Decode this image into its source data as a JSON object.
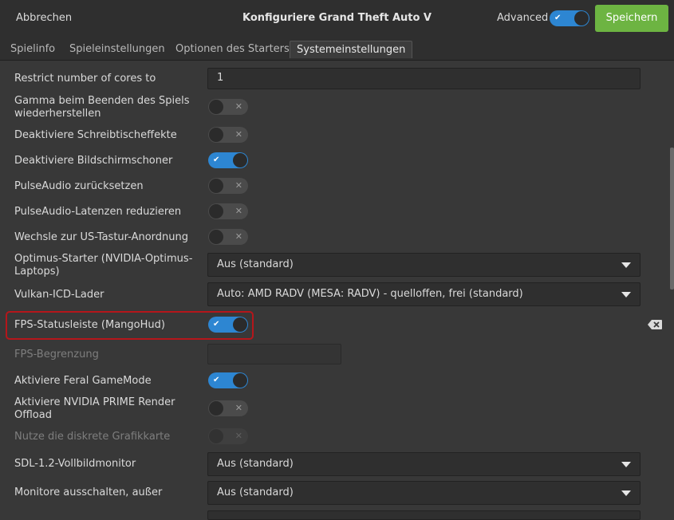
{
  "header": {
    "cancel_label": "Abbrechen",
    "title": "Konfiguriere Grand Theft Auto V",
    "advanced_label": "Advanced",
    "advanced_on": true,
    "save_label": "Speichern"
  },
  "tabs": [
    {
      "label": "Spielinfo"
    },
    {
      "label": "Spieleinstellungen"
    },
    {
      "label": "Optionen des Starters"
    },
    {
      "label": "Systemeinstellungen",
      "active": true
    }
  ],
  "settings": {
    "restrict_cores": {
      "label": "Restrict number of cores to",
      "value": "1"
    },
    "gamma_restore": {
      "label": "Gamma beim Beenden des Spiels wiederherstellen",
      "on": false
    },
    "disable_desktop_effects": {
      "label": "Deaktiviere Schreibtischeffekte",
      "on": false
    },
    "disable_screensaver": {
      "label": "Deaktiviere Bildschirmschoner",
      "on": true
    },
    "pulseaudio_reset": {
      "label": "PulseAudio zurücksetzen",
      "on": false
    },
    "pulseaudio_latency": {
      "label": "PulseAudio-Latenzen reduzieren",
      "on": false
    },
    "us_keyboard": {
      "label": "Wechsle zur US-Tastur-Anordnung",
      "on": false
    },
    "optimus": {
      "label": "Optimus-Starter (NVIDIA-Optimus-Laptops)",
      "value": "Aus (standard)"
    },
    "vulkan_icd": {
      "label": "Vulkan-ICD-Lader",
      "value": "Auto: AMD RADV (MESA: RADV) - quelloffen, frei (standard)"
    },
    "fps_mangohud": {
      "label": "FPS-Statusleiste (MangoHud)",
      "on": true
    },
    "fps_limit": {
      "label": "FPS-Begrenzung",
      "value": ""
    },
    "feral_gamemode": {
      "label": "Aktiviere Feral GameMode",
      "on": true
    },
    "nvidia_prime": {
      "label": "Aktiviere NVIDIA PRIME Render Offload",
      "on": false
    },
    "discrete_gpu": {
      "label": "Nutze die diskrete Grafikkarte",
      "on": false
    },
    "sdl_monitor": {
      "label": "SDL-1.2-Vollbildmonitor",
      "value": "Aus (standard)"
    },
    "monitors_off": {
      "label": "Monitore ausschalten, außer",
      "value": "Aus (standard)"
    }
  },
  "icons": {
    "check": "✔",
    "cross": "✕"
  },
  "colors": {
    "accent": "#2d86d2",
    "save": "#6db442",
    "highlight": "#b5161b"
  }
}
